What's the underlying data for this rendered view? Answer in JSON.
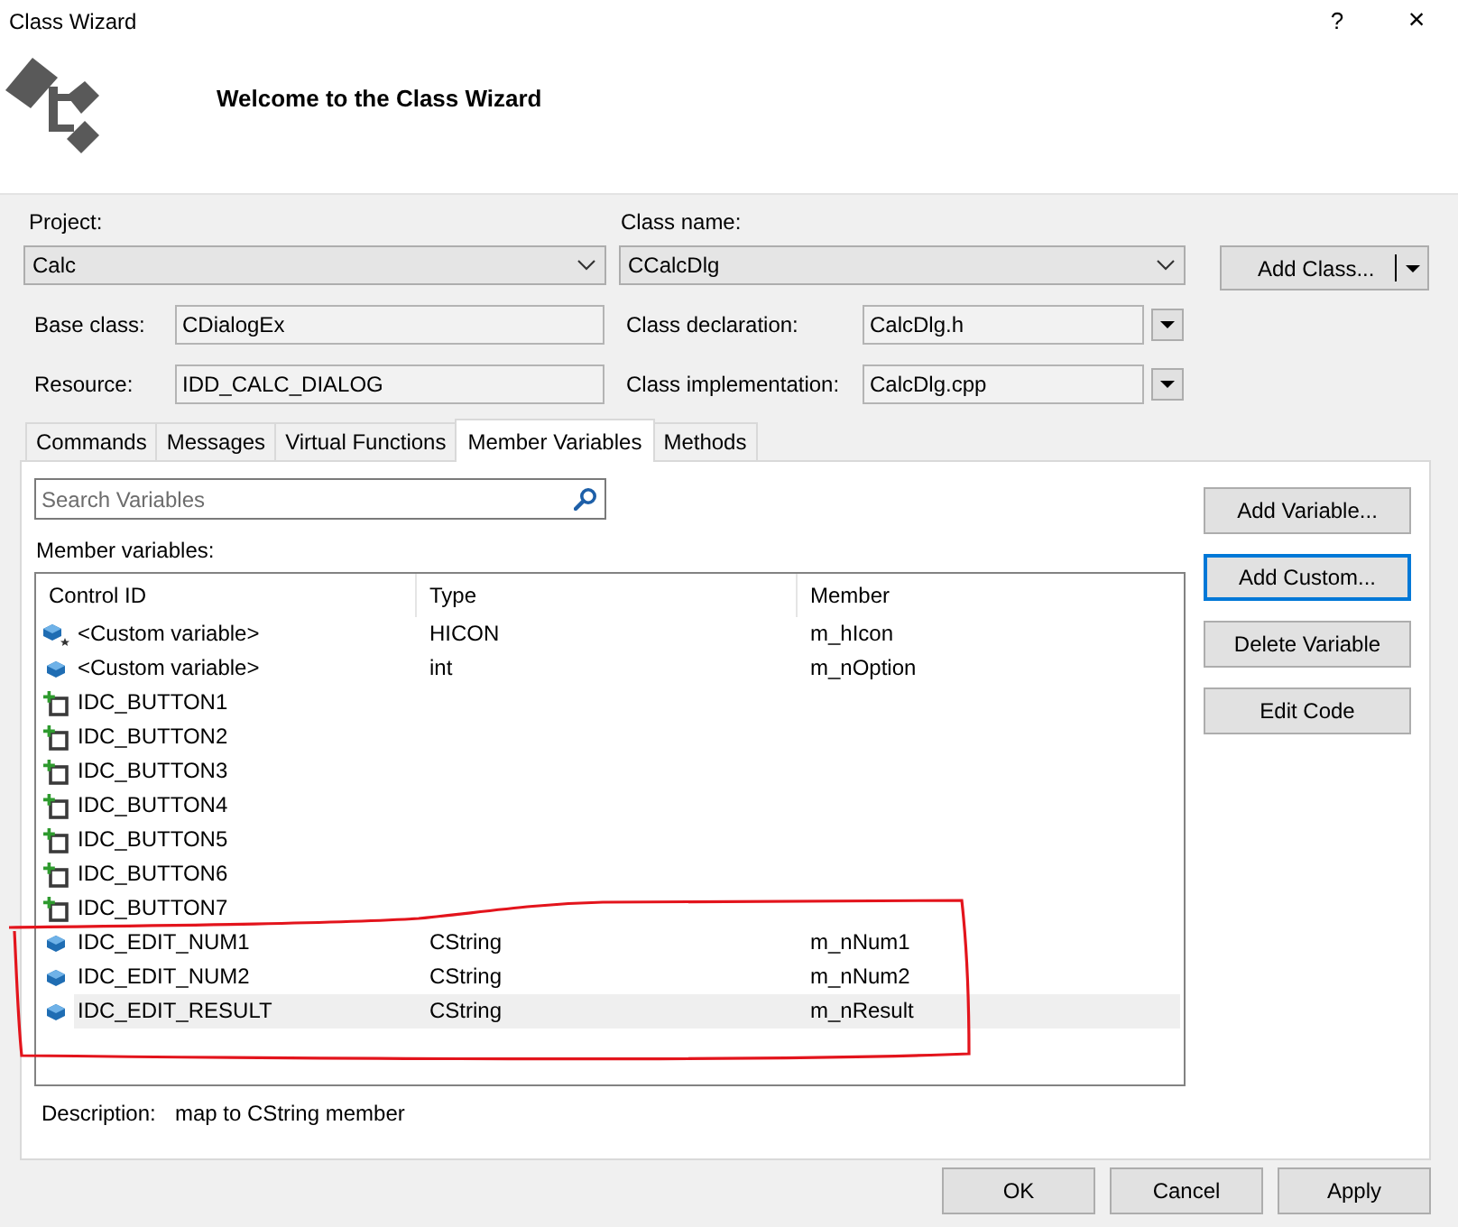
{
  "window": {
    "title": "Class Wizard",
    "buttons": [
      {
        "kind": "help",
        "label": "?"
      },
      {
        "kind": "close",
        "label": "×"
      }
    ]
  },
  "header": {
    "title": "Welcome to the Class Wizard"
  },
  "project": {
    "label": "Project:",
    "value": "Calc"
  },
  "class_name": {
    "label": "Class name:",
    "value": "CCalcDlg"
  },
  "add_class": {
    "label": "Add Class..."
  },
  "base_class": {
    "label": "Base class:",
    "value": "CDialogEx"
  },
  "class_declaration": {
    "label": "Class declaration:",
    "value": "CalcDlg.h"
  },
  "resource": {
    "label": "Resource:",
    "value": "IDD_CALC_DIALOG"
  },
  "class_implementation": {
    "label": "Class implementation:",
    "value": "CalcDlg.cpp"
  },
  "tabs": [
    {
      "label": "Commands",
      "selected": false
    },
    {
      "label": "Messages",
      "selected": false
    },
    {
      "label": "Virtual Functions",
      "selected": false
    },
    {
      "label": "Member Variables",
      "selected": true
    },
    {
      "label": "Methods",
      "selected": false
    }
  ],
  "search": {
    "placeholder": "Search Variables"
  },
  "list_label": "Member variables:",
  "table": {
    "columns": [
      "Control ID",
      "Type",
      "Member"
    ],
    "rows": [
      {
        "kind": "static",
        "control_id": "<Custom variable>",
        "type": "HICON",
        "member": "m_hIcon",
        "selected": false
      },
      {
        "kind": "member",
        "control_id": "<Custom variable>",
        "type": "int",
        "member": "m_nOption",
        "selected": false
      },
      {
        "kind": "control",
        "control_id": "IDC_BUTTON1",
        "selected": false
      },
      {
        "kind": "control",
        "control_id": "IDC_BUTTON2",
        "selected": false
      },
      {
        "kind": "control",
        "control_id": "IDC_BUTTON3",
        "selected": false
      },
      {
        "kind": "control",
        "control_id": "IDC_BUTTON4",
        "selected": false
      },
      {
        "kind": "control",
        "control_id": "IDC_BUTTON5",
        "selected": false
      },
      {
        "kind": "control",
        "control_id": "IDC_BUTTON6",
        "selected": false
      },
      {
        "kind": "control",
        "control_id": "IDC_BUTTON7",
        "selected": false
      },
      {
        "kind": "member",
        "control_id": "IDC_EDIT_NUM1",
        "type": "CString",
        "member": "m_nNum1",
        "selected": false
      },
      {
        "kind": "member",
        "control_id": "IDC_EDIT_NUM2",
        "type": "CString",
        "member": "m_nNum2",
        "selected": false
      },
      {
        "kind": "member",
        "control_id": "IDC_EDIT_RESULT",
        "type": "CString",
        "member": "m_nResult",
        "selected": true
      }
    ]
  },
  "annotation": {
    "kind": "loop"
  },
  "description": {
    "label": "Description:",
    "value": "map to CString member"
  },
  "side_buttons": [
    {
      "label": "Add Variable...",
      "focused": false
    },
    {
      "label": "Add Custom...",
      "focused": true
    },
    {
      "label": "Delete Variable",
      "focused": false
    },
    {
      "label": "Edit Code",
      "focused": false
    }
  ],
  "footer_buttons": [
    "OK",
    "Cancel",
    "Apply"
  ]
}
